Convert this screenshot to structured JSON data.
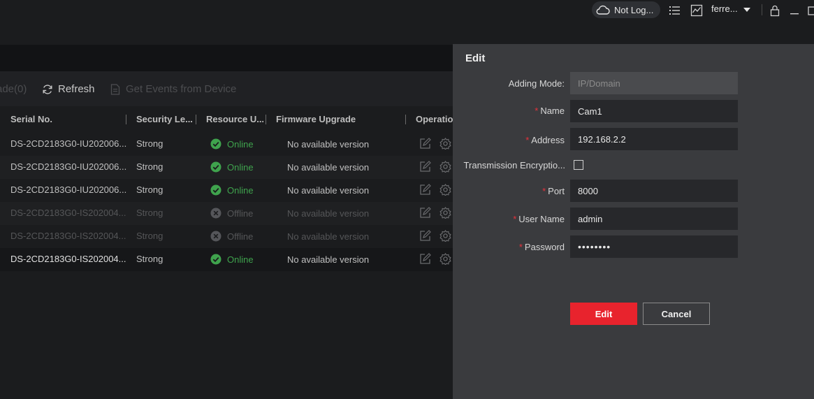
{
  "topbar": {
    "cloud_status": "Not Log...",
    "user_name": "ferre..."
  },
  "toolbar": {
    "upgrade_label": "ade(0)",
    "refresh_label": "Refresh",
    "events_label": "Get Events from Device"
  },
  "table": {
    "columns": [
      "Serial No.",
      "Security Le...",
      "Resource U...",
      "Firmware Upgrade",
      "Operatio"
    ],
    "rows": [
      {
        "serial": "DS-2CD2183G0-IU202006...",
        "security": "Strong",
        "status": "Online",
        "firmware": "No available version"
      },
      {
        "serial": "DS-2CD2183G0-IU202006...",
        "security": "Strong",
        "status": "Online",
        "firmware": "No available version"
      },
      {
        "serial": "DS-2CD2183G0-IU202006...",
        "security": "Strong",
        "status": "Online",
        "firmware": "No available version"
      },
      {
        "serial": "DS-2CD2183G0-IS202004...",
        "security": "Strong",
        "status": "Offline",
        "firmware": "No available version"
      },
      {
        "serial": "DS-2CD2183G0-IS202004...",
        "security": "Strong",
        "status": "Offline",
        "firmware": "No available version"
      },
      {
        "serial": "DS-2CD2183G0-IS202004...",
        "security": "Strong",
        "status": "Online",
        "firmware": "No available version"
      }
    ]
  },
  "edit_panel": {
    "title": "Edit",
    "adding_mode_label": "Adding Mode:",
    "adding_mode_value": "IP/Domain",
    "name_label": "Name",
    "name_value": "Cam1",
    "address_label": "Address",
    "address_value": "192.168.2.2",
    "encryption_label": "Transmission Encryptio...",
    "port_label": "Port",
    "port_value": "8000",
    "username_label": "User Name",
    "username_value": "admin",
    "password_label": "Password",
    "password_value": "••••••••",
    "required_mark": "*",
    "edit_button": "Edit",
    "cancel_button": "Cancel"
  },
  "colors": {
    "accent": "#e8232d",
    "online": "#3fa34d",
    "panel": "#3a3b3e"
  }
}
